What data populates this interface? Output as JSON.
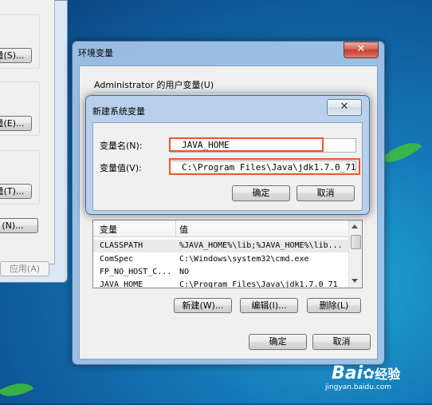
{
  "colors": {
    "highlight": "#e8582a",
    "desktop": "#1579b8"
  },
  "background_window": {
    "buttons": [
      "量(S)...",
      "量(E)...",
      "量(T)...",
      "(N)...",
      "应用(A)"
    ]
  },
  "env_dialog": {
    "title": "环境变量",
    "user_vars_label": "Administrator 的用户变量(U)",
    "system_vars": {
      "columns": [
        "变量",
        "值"
      ],
      "rows": [
        {
          "name": "CLASSPATH",
          "value": "%JAVA_HOME%\\lib;%JAVA_HOME%\\lib..."
        },
        {
          "name": "ComSpec",
          "value": "C:\\Windows\\system32\\cmd.exe"
        },
        {
          "name": "FP_NO_HOST_C...",
          "value": "NO"
        },
        {
          "name": "JAVA_HOME",
          "value": "C:\\Program Files\\Java\\jdk1.7.0_71"
        }
      ]
    },
    "new_button": "新建(W)...",
    "edit_button": "编辑(I)...",
    "delete_button": "删除(L)",
    "ok_button": "确定",
    "cancel_button": "取消",
    "close_glyph": "✕"
  },
  "new_var_dialog": {
    "title": "新建系统变量",
    "name_label": "变量名(N):",
    "name_value": "JAVA_HOME",
    "value_label": "变量值(V):",
    "value_value": "C:\\Program Files\\Java\\jdk1.7.0_71",
    "ok_button": "确定",
    "cancel_button": "取消",
    "close_glyph": "✕"
  },
  "watermark": {
    "brand": "Bai",
    "brand2": "经验",
    "url": "jingyan.baidu.com"
  }
}
